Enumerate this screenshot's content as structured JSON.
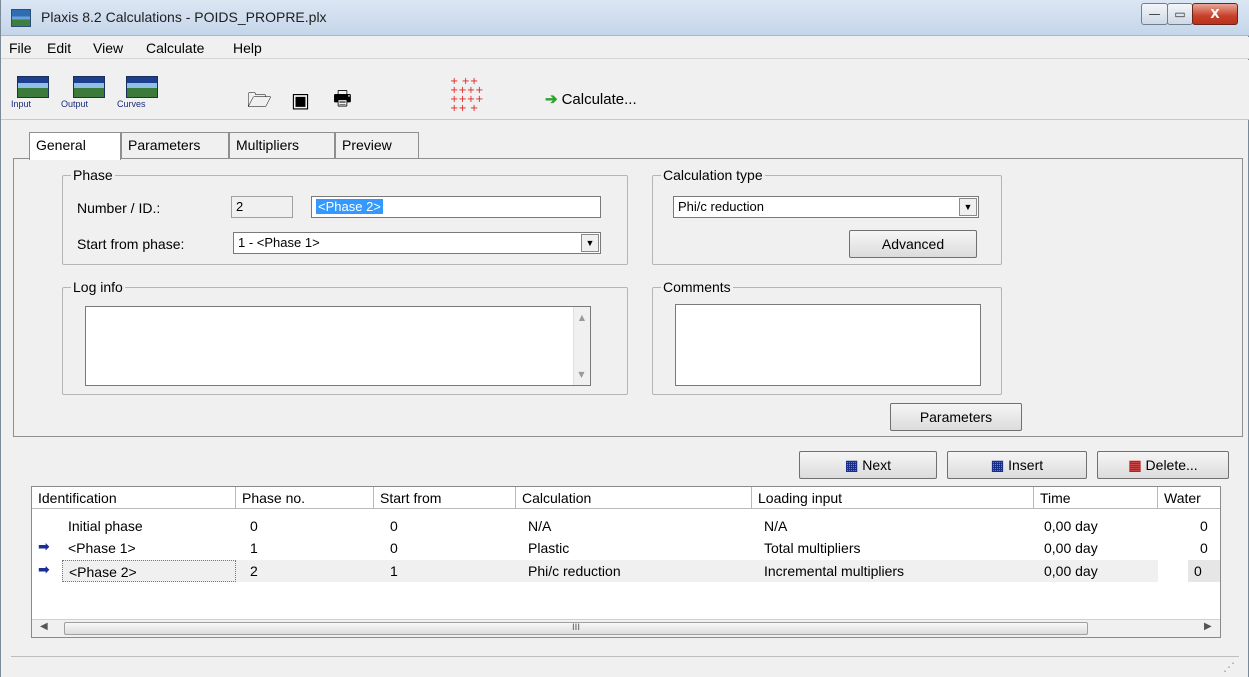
{
  "window": {
    "title": "Plaxis 8.2 Calculations - POIDS_PROPRE.plx",
    "min": "—",
    "max": "▭",
    "close": "X"
  },
  "menu": [
    "File",
    "Edit",
    "View",
    "Calculate",
    "Help"
  ],
  "toolbar": {
    "input_label": "Input",
    "output_label": "Output",
    "curves_label": "Curves",
    "open_icon": "folder-open-icon",
    "save_icon": "floppy-disk-icon",
    "print_icon": "printer-icon",
    "points_icon": "select-points-icon",
    "calculate_label": "Calculate..."
  },
  "tabs": {
    "general": "General",
    "parameters": "Parameters",
    "multipliers": "Multipliers",
    "preview": "Preview"
  },
  "phase": {
    "legend": "Phase",
    "number_label": "Number / ID.:",
    "number_value": "2",
    "id_value": "<Phase 2>",
    "start_label": "Start from phase:",
    "start_value": "1 - <Phase 1>"
  },
  "calculation_type": {
    "legend": "Calculation type",
    "value": "Phi/c reduction",
    "advanced_label": "Advanced"
  },
  "log": {
    "legend": "Log info"
  },
  "comments": {
    "legend": "Comments"
  },
  "parameters_button": "Parameters",
  "actions": {
    "next": "Next",
    "insert": "Insert",
    "delete": "Delete..."
  },
  "table": {
    "headers": [
      "Identification",
      "Phase no.",
      "Start from",
      "Calculation",
      "Loading input",
      "Time",
      "Water"
    ],
    "rows": [
      [
        "Initial phase",
        "0",
        "0",
        "N/A",
        "N/A",
        "0,00 day",
        "0"
      ],
      [
        "<Phase 1>",
        "1",
        "0",
        "Plastic",
        "Total multipliers",
        "0,00 day",
        "0"
      ],
      [
        "<Phase 2>",
        "2",
        "1",
        "Phi/c reduction",
        "Incremental multipliers",
        "0,00 day",
        "0"
      ]
    ],
    "scroll_thumb": "III"
  },
  "colors": {
    "selection": "#3399ff",
    "arrow": "#1a2d99",
    "calculate_arrow": "#2aa52a"
  }
}
